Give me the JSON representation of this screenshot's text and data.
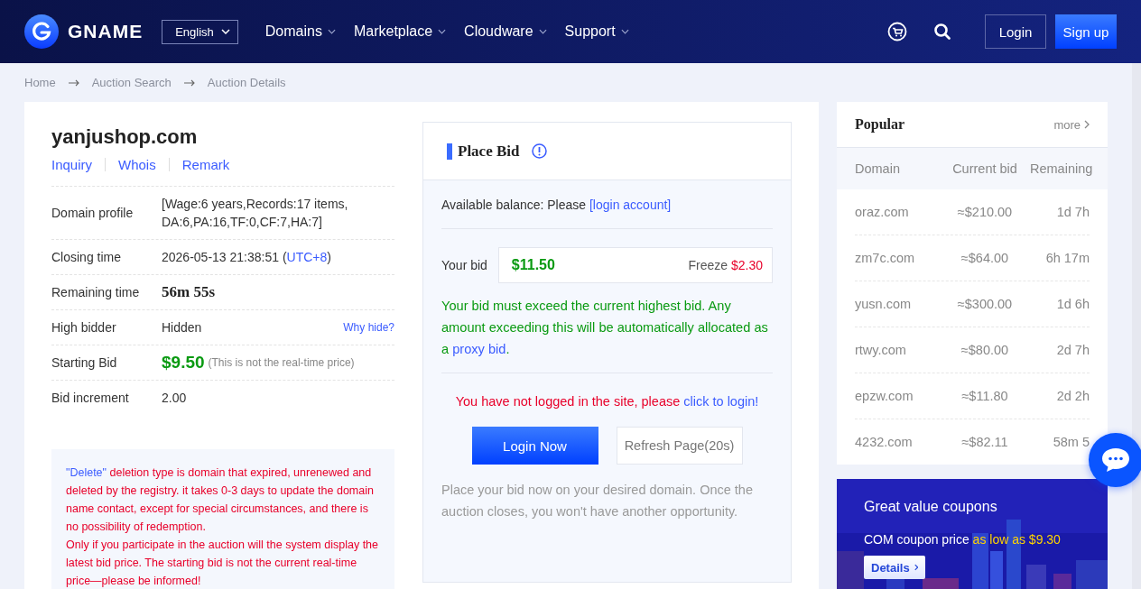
{
  "header": {
    "brand": "GNAME",
    "language": "English",
    "nav": [
      "Domains",
      "Marketplace",
      "Cloudware",
      "Support"
    ],
    "login": "Login",
    "signup": "Sign up"
  },
  "breadcrumb": [
    "Home",
    "Auction Search",
    "Auction Details"
  ],
  "domain": {
    "name": "yanjushop.com",
    "links": [
      "Inquiry",
      "Whois",
      "Remark"
    ]
  },
  "details": [
    {
      "kind": "text",
      "label": "Domain profile",
      "value": "[Wage:6 years,Records:17 items, DA:6,PA:16,TF:0,CF:7,HA:7]"
    },
    {
      "kind": "segments",
      "label": "Closing time",
      "parts": [
        {
          "kind": "plain",
          "text": "2026-05-13 21:38:51 ("
        },
        {
          "kind": "link",
          "text": "UTC+8"
        },
        {
          "kind": "plain",
          "text": ")"
        }
      ]
    },
    {
      "kind": "countdown",
      "label": "Remaining time",
      "value": "56m 55s"
    },
    {
      "kind": "hidden",
      "label": "High bidder",
      "value": "Hidden",
      "aside": "Why hide?"
    },
    {
      "kind": "price",
      "label": "Starting Bid",
      "value": "$9.50",
      "note": "(This is not the real-time price)"
    },
    {
      "kind": "text",
      "label": "Bid increment",
      "value": "2.00"
    }
  ],
  "notice": [
    [
      {
        "kind": "link",
        "text": "\"Delete\""
      },
      {
        "kind": "plain",
        "text": " deletion type is domain that expired, unrenewed and deleted by the registry. it takes 0-3 days to update the domain name contact, except for special circumstances, and there is no possibility of redemption."
      }
    ],
    [
      {
        "kind": "plain",
        "text": "Only if you participate in the auction will the system display the latest bid price. The starting bid is not the current real-time price—please be informed!"
      }
    ]
  ],
  "bid": {
    "title": "Place Bid",
    "balance": [
      {
        "kind": "plain",
        "text": "Available balance: Please "
      },
      {
        "kind": "link",
        "text": "[login account]"
      }
    ],
    "label": "Your bid",
    "value": "$11.50",
    "freeze_label": "Freeze",
    "freeze_amount": "$2.30",
    "hint": [
      {
        "kind": "plain",
        "text": "Your bid must exceed the current highest bid. Any amount exceeding this will be automatically allocated as a "
      },
      {
        "kind": "link",
        "text": "proxy bid"
      },
      {
        "kind": "plain",
        "text": "."
      }
    ],
    "warning": [
      {
        "kind": "plain",
        "text": "You have not logged in the site, please "
      },
      {
        "kind": "link",
        "text": "click to login!"
      }
    ],
    "login_button": "Login Now",
    "refresh_button": "Refresh Page(20s)",
    "note": "Place your bid now on your desired domain. Once the auction closes, you won't have another opportunity."
  },
  "popular": {
    "title": "Popular",
    "more": "more",
    "columns": [
      "Domain",
      "Current bid",
      "Remaining"
    ],
    "rows": [
      {
        "domain": "oraz.com",
        "bid": "≈$210.00",
        "remaining": "1d 7h"
      },
      {
        "domain": "zm7c.com",
        "bid": "≈$64.00",
        "remaining": "6h 17m"
      },
      {
        "domain": "yusn.com",
        "bid": "≈$300.00",
        "remaining": "1d 6h"
      },
      {
        "domain": "rtwy.com",
        "bid": "≈$80.00",
        "remaining": "2d 7h"
      },
      {
        "domain": "epzw.com",
        "bid": "≈$11.80",
        "remaining": "2d 2h"
      },
      {
        "domain": "4232.com",
        "bid": "≈$82.11",
        "remaining": "58m 5"
      }
    ]
  },
  "coupon": {
    "title": "Great value coupons",
    "parts": [
      {
        "kind": "plain",
        "text": "COM coupon price "
      },
      {
        "kind": "highlight",
        "text": "as low as $9.30"
      }
    ],
    "button": "Details"
  }
}
